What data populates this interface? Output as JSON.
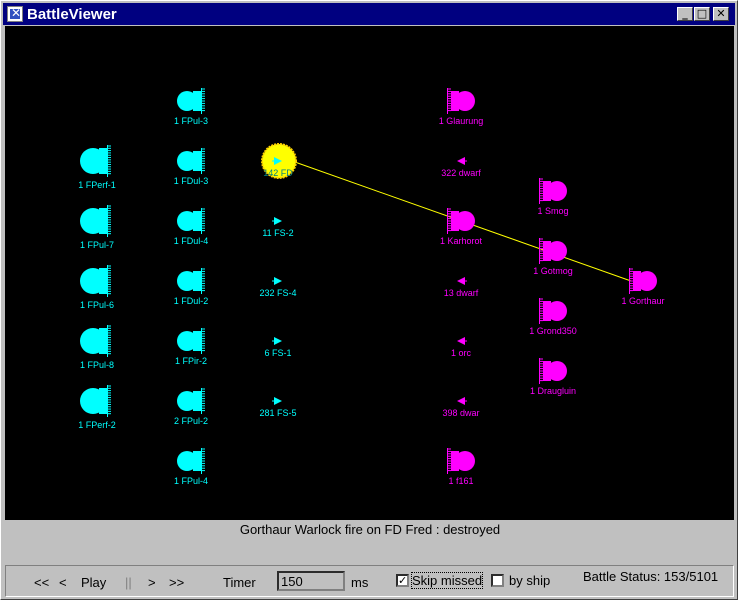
{
  "window": {
    "title": "BattleViewer",
    "minimize": "_",
    "maximize": "□",
    "close": "✕"
  },
  "battle": {
    "fire_line": {
      "from": "FD Fred",
      "to": "1 Gorthaur"
    },
    "left_side": [
      {
        "label": "1 FPerf-1",
        "kind": "big-ship"
      },
      {
        "label": "1 FPul-7",
        "kind": "big-ship"
      },
      {
        "label": "1 FPul-6",
        "kind": "big-ship"
      },
      {
        "label": "1 FPul-8",
        "kind": "big-ship"
      },
      {
        "label": "1 FPerf-2",
        "kind": "big-ship"
      },
      {
        "label": "1 FPul-3",
        "kind": "ship"
      },
      {
        "label": "1 FDul-3",
        "kind": "ship"
      },
      {
        "label": "1 FDul-4",
        "kind": "ship"
      },
      {
        "label": "1 FDul-2",
        "kind": "ship"
      },
      {
        "label": "1 FPir-2",
        "kind": "ship"
      },
      {
        "label": "2 FPul-2",
        "kind": "ship"
      },
      {
        "label": "1 FPul-4",
        "kind": "ship"
      },
      {
        "label": "142 FD",
        "kind": "drone",
        "highlighted": true
      },
      {
        "label": "11 FS-2",
        "kind": "drone"
      },
      {
        "label": "232 FS-4",
        "kind": "drone"
      },
      {
        "label": "6 FS-1",
        "kind": "drone"
      },
      {
        "label": "281 FS-5",
        "kind": "drone"
      }
    ],
    "right_side": [
      {
        "label": "1 Glaurung",
        "kind": "ship"
      },
      {
        "label": "322 dwarf",
        "kind": "drone"
      },
      {
        "label": "1 Karhorot",
        "kind": "ship"
      },
      {
        "label": "13 dwarf",
        "kind": "drone"
      },
      {
        "label": "1 orc",
        "kind": "drone"
      },
      {
        "label": "398 dwar",
        "kind": "drone"
      },
      {
        "label": "1 f161",
        "kind": "ship"
      },
      {
        "label": "1 Smog",
        "kind": "ship"
      },
      {
        "label": "1 Gotmog",
        "kind": "ship"
      },
      {
        "label": "1 Grond350",
        "kind": "ship"
      },
      {
        "label": "1 Draugluin",
        "kind": "ship"
      },
      {
        "label": "1 Gorthaur",
        "kind": "ship"
      }
    ],
    "colors": {
      "side_a": "#00ffff",
      "side_b": "#ff00ff",
      "highlight": "#ffff00",
      "fire_line": "#ffff00"
    }
  },
  "status_text": "Gorthaur Warlock fire on FD Fred :  destroyed",
  "controls": {
    "rewind": "<<",
    "back": "<",
    "play": "Play",
    "pause": "||",
    "forward": ">",
    "fast_forward": ">>",
    "timer_label": "Timer",
    "timer_value": "150",
    "timer_unit": "ms",
    "skip_missed_label": "Skip missed",
    "skip_missed_checked": "✓",
    "by_ship_label": "by ship",
    "battle_status": "Battle Status: 153/5101"
  }
}
